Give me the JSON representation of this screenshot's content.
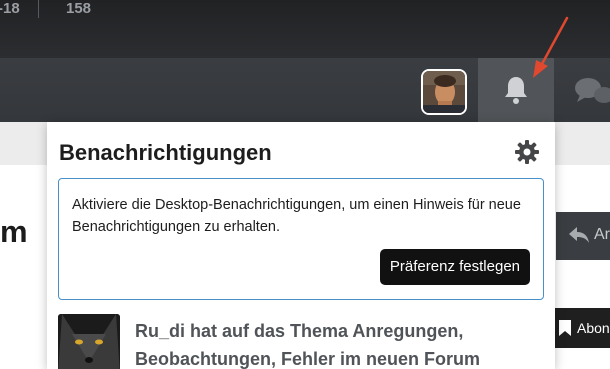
{
  "header": {
    "stats": [
      "-18",
      "158"
    ]
  },
  "navbar": {
    "avatar_icon": "user-avatar-icon",
    "bell_icon": "bell-icon",
    "chat_icon": "chat-bubbles-icon"
  },
  "page": {
    "heading_fragment": "m",
    "right_button_fragment": "Ar",
    "bookmark_fragment": "Abon"
  },
  "notifications": {
    "title": "Benachrichtigungen",
    "settings_icon": "gear-icon",
    "info_text": "Aktiviere die Desktop-Benachrichtigungen, um einen Hinweis für neue Benachrichtigungen zu erhalten.",
    "preference_button": "Präferenz festlegen",
    "items": [
      {
        "text": "Ru_di hat auf das Thema Anregungen, Beobachtungen, Fehler im neuen Forum"
      }
    ]
  },
  "colors": {
    "arrow": "#e0482f",
    "info_border": "#4a90c8",
    "button_bg": "#111111"
  }
}
